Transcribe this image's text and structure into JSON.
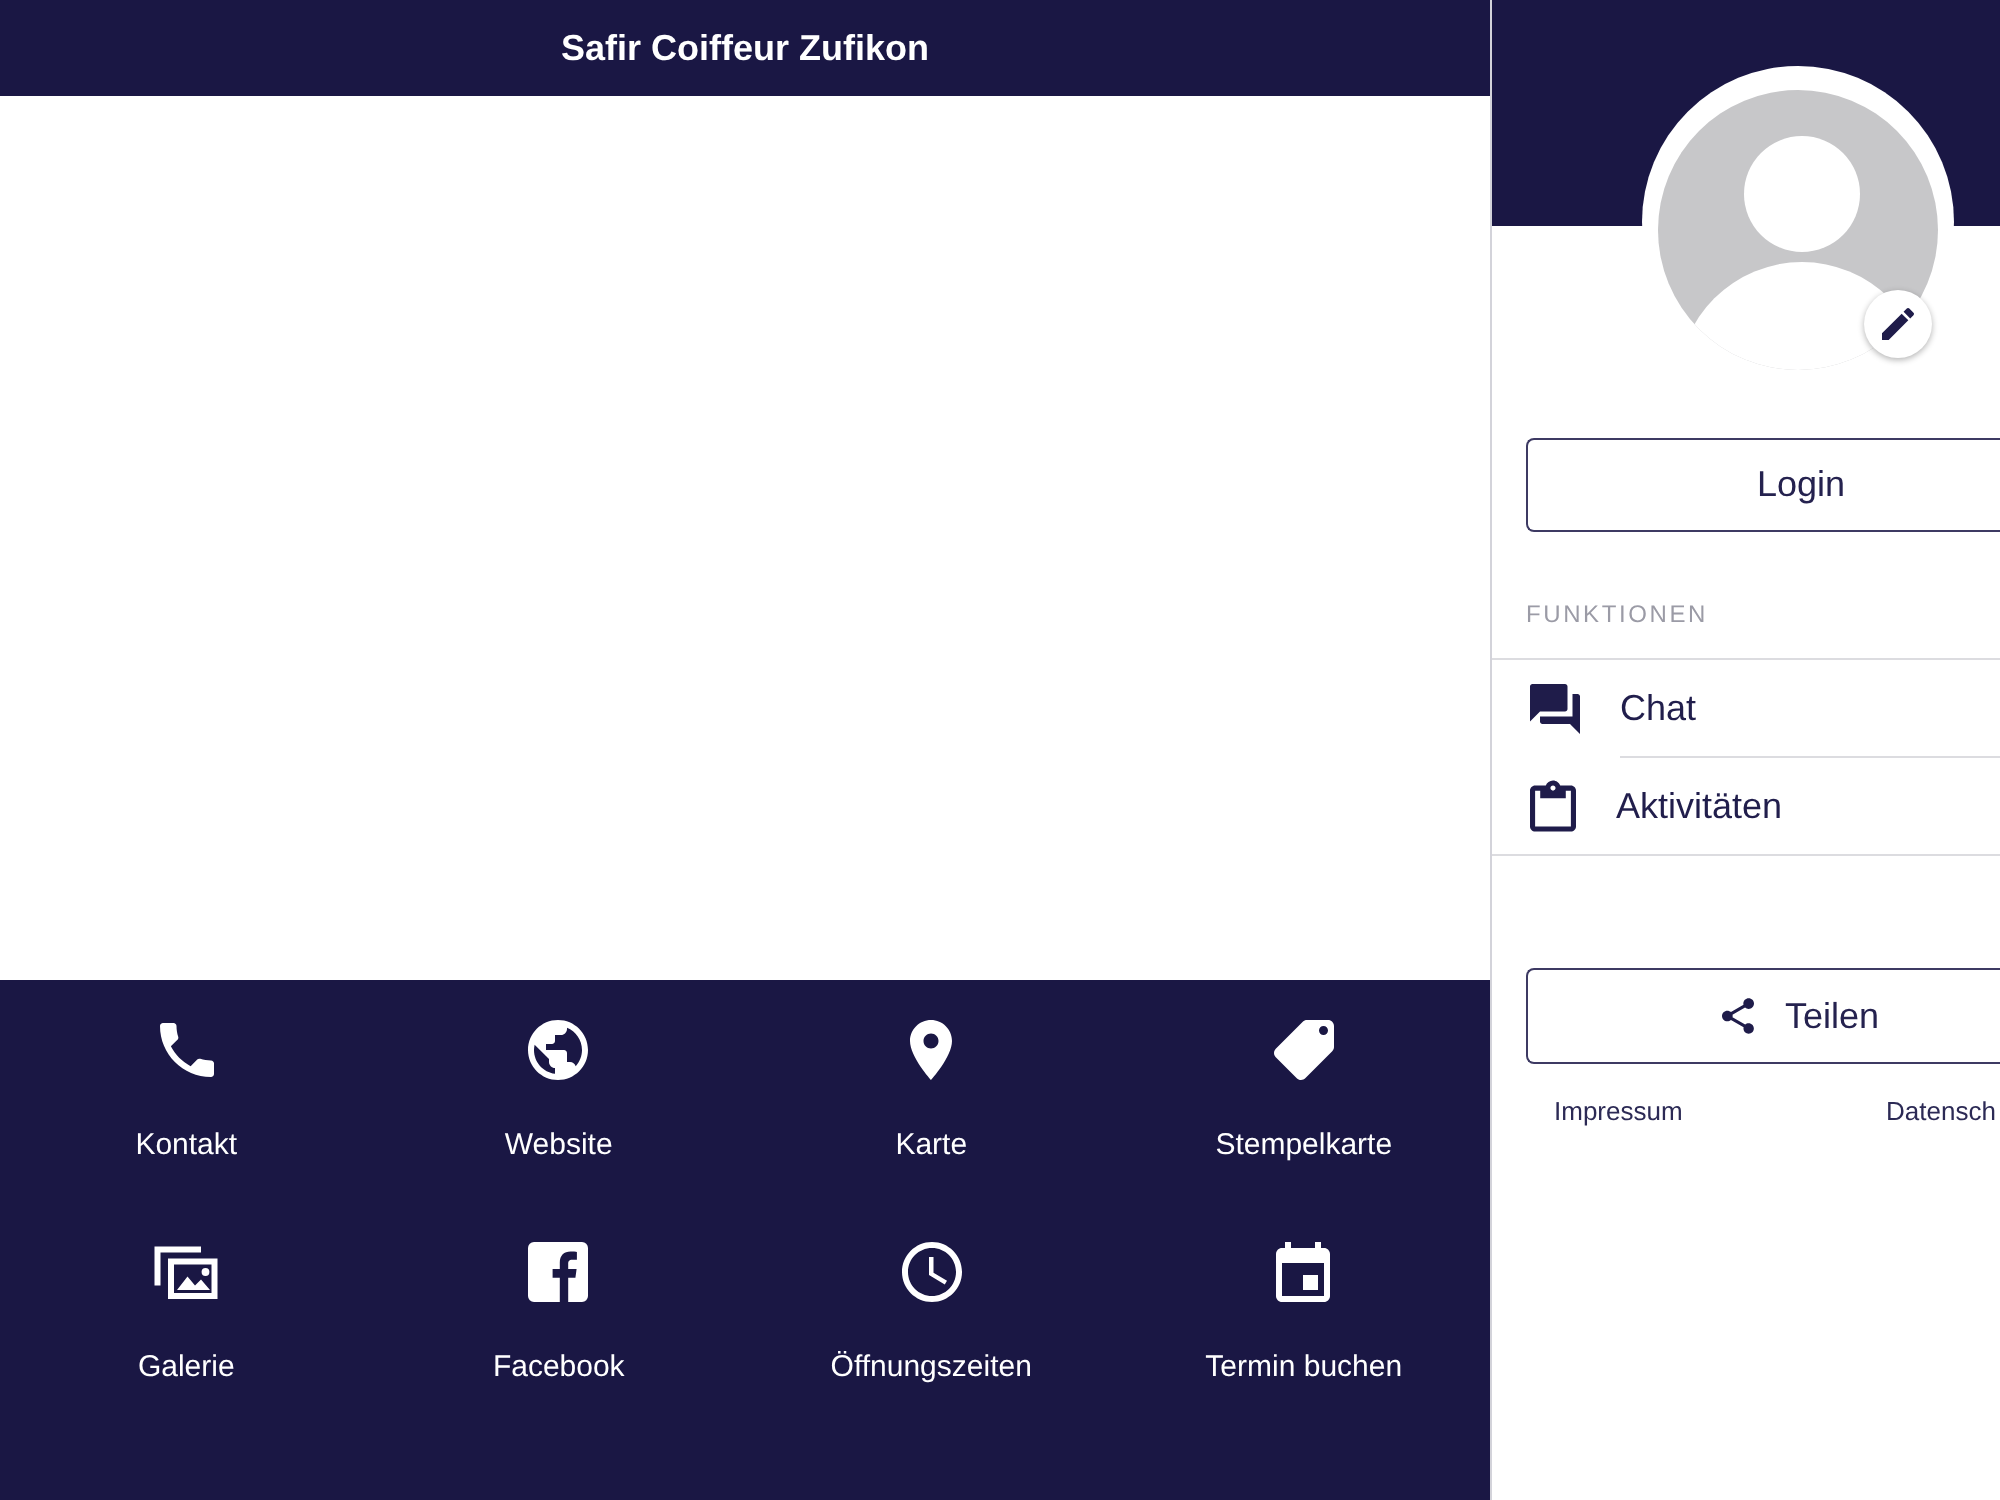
{
  "header": {
    "title": "Safir Coiffeur Zufikon"
  },
  "shortcuts": [
    {
      "label": "Kontakt"
    },
    {
      "label": "Website"
    },
    {
      "label": "Karte"
    },
    {
      "label": "Stempelkarte"
    },
    {
      "label": "Galerie"
    },
    {
      "label": "Facebook"
    },
    {
      "label": "Öffnungszeiten"
    },
    {
      "label": "Termin buchen"
    }
  ],
  "profile": {
    "login_button": "Login"
  },
  "functions": {
    "heading": "FUNKTIONEN",
    "items": [
      {
        "label": "Chat"
      },
      {
        "label": "Aktivitäten"
      }
    ]
  },
  "share_button": {
    "label": "Teilen"
  },
  "footer_links": [
    "Impressum",
    "Datensch"
  ]
}
